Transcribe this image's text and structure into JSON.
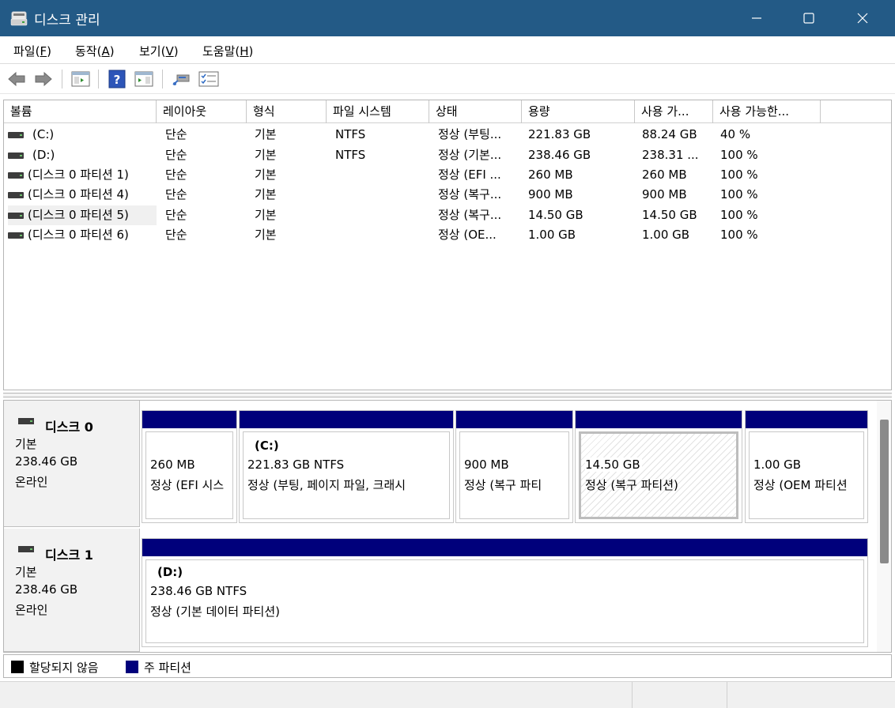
{
  "window": {
    "title": "디스크 관리",
    "icon": "disk-management-icon",
    "buttons": [
      "minimize-icon",
      "maximize-icon",
      "close-icon"
    ]
  },
  "menu": [
    {
      "label": "파일(",
      "key": "F",
      "suffix": ")"
    },
    {
      "label": "동작(",
      "key": "A",
      "suffix": ")"
    },
    {
      "label": "보기(",
      "key": "V",
      "suffix": ")"
    },
    {
      "label": "도움말(",
      "key": "H",
      "suffix": ")"
    }
  ],
  "toolbar": {
    "icons": [
      "back-arrow-icon",
      "forward-arrow-icon",
      "show-hide-console-tree-icon",
      "help-icon",
      "show-hide-action-pane-icon",
      "connect-drive-icon",
      "properties-checklist-icon"
    ]
  },
  "columns": [
    "볼륨",
    "레이아웃",
    "형식",
    "파일 시스템",
    "상태",
    "용량",
    "사용 가...",
    "사용 가능한..."
  ],
  "volumes": [
    {
      "name": "(C:)",
      "layout": "단순",
      "type": "기본",
      "fs": "NTFS",
      "status": "정상 (부팅...",
      "capacity": "221.83 GB",
      "free": "88.24 GB",
      "pct": "40 %"
    },
    {
      "name": "(D:)",
      "layout": "단순",
      "type": "기본",
      "fs": "NTFS",
      "status": "정상 (기본...",
      "capacity": "238.46 GB",
      "free": "238.31 ...",
      "pct": "100 %"
    },
    {
      "name": "(디스크 0 파티션 1)",
      "layout": "단순",
      "type": "기본",
      "fs": "",
      "status": "정상 (EFI ...",
      "capacity": "260 MB",
      "free": "260 MB",
      "pct": "100 %"
    },
    {
      "name": "(디스크 0 파티션 4)",
      "layout": "단순",
      "type": "기본",
      "fs": "",
      "status": "정상 (복구...",
      "capacity": "900 MB",
      "free": "900 MB",
      "pct": "100 %"
    },
    {
      "name": "(디스크 0 파티션 5)",
      "layout": "단순",
      "type": "기본",
      "fs": "",
      "status": "정상 (복구...",
      "capacity": "14.50 GB",
      "free": "14.50 GB",
      "pct": "100 %"
    },
    {
      "name": "(디스크 0 파티션 6)",
      "layout": "단순",
      "type": "기본",
      "fs": "",
      "status": "정상 (OE...",
      "capacity": "1.00 GB",
      "free": "1.00 GB",
      "pct": "100 %"
    }
  ],
  "disks": [
    {
      "name": "디스크 0",
      "type": "기본",
      "size": "238.46 GB",
      "state": "온라인",
      "partitions": [
        {
          "label": "",
          "size": "260 MB",
          "status": "정상 (EFI 시스"
        },
        {
          "label": "(C:)",
          "size": "221.83 GB NTFS",
          "status": "정상 (부팅, 페이지 파일, 크래시"
        },
        {
          "label": "",
          "size": "900 MB",
          "status": "정상 (복구 파티"
        },
        {
          "label": "",
          "size": "14.50 GB",
          "status": "정상 (복구 파티션)"
        },
        {
          "label": "",
          "size": "1.00 GB",
          "status": "정상 (OEM 파티션"
        }
      ]
    },
    {
      "name": "디스크 1",
      "type": "기본",
      "size": "238.46 GB",
      "state": "온라인",
      "partitions": [
        {
          "label": "(D:)",
          "size": "238.46 GB NTFS",
          "status": "정상 (기본 데이터 파티션)"
        }
      ]
    }
  ],
  "legend": [
    {
      "label": "할당되지 않음",
      "color": "#000000"
    },
    {
      "label": "주 파티션",
      "color": "#00007b"
    }
  ]
}
